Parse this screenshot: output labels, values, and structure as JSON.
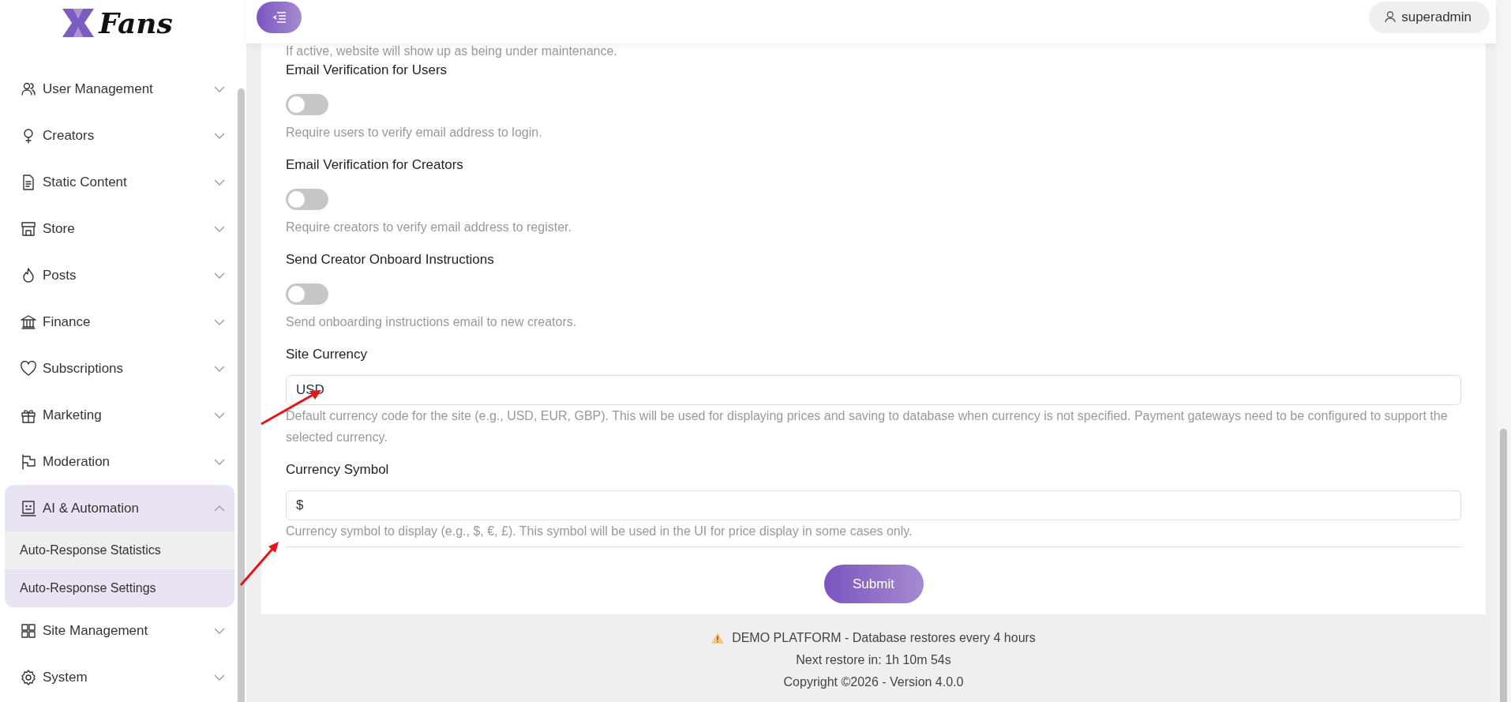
{
  "logo": {
    "text": "Fans"
  },
  "sidebar": {
    "items": [
      {
        "label": "User Management",
        "expanded": false
      },
      {
        "label": "Creators",
        "expanded": false
      },
      {
        "label": "Static Content",
        "expanded": false
      },
      {
        "label": "Store",
        "expanded": false
      },
      {
        "label": "Posts",
        "expanded": false
      },
      {
        "label": "Finance",
        "expanded": false
      },
      {
        "label": "Subscriptions",
        "expanded": false
      },
      {
        "label": "Marketing",
        "expanded": false
      },
      {
        "label": "Moderation",
        "expanded": false
      },
      {
        "label": "AI & Automation",
        "expanded": true,
        "children": [
          {
            "label": "Auto-Response Statistics",
            "selected": false
          },
          {
            "label": "Auto-Response Settings",
            "selected": true
          }
        ]
      },
      {
        "label": "Site Management",
        "expanded": false
      },
      {
        "label": "System",
        "expanded": false
      }
    ]
  },
  "header": {
    "user": "superadmin"
  },
  "settings": [
    {
      "kind": "note",
      "help": "If active, website will show up as being under maintenance."
    },
    {
      "kind": "toggle",
      "label": "Email Verification for Users",
      "on": false,
      "help": "Require users to verify email address to login."
    },
    {
      "kind": "toggle",
      "label": "Email Verification for Creators",
      "on": false,
      "help": "Require creators to verify email address to register."
    },
    {
      "kind": "toggle",
      "label": "Send Creator Onboard Instructions",
      "on": false,
      "help": "Send onboarding instructions email to new creators."
    },
    {
      "kind": "text",
      "label": "Site Currency",
      "value": "USD",
      "help": "Default currency code for the site (e.g., USD, EUR, GBP). This will be used for displaying prices and saving to database when currency is not specified. Payment gateways need to be configured to support the selected currency."
    },
    {
      "kind": "text",
      "label": "Currency Symbol",
      "value": "$",
      "help": "Currency symbol to display (e.g., $, €, £). This symbol will be used in the UI for price display in some cases only."
    }
  ],
  "submit": "Submit",
  "footer": {
    "notice": "DEMO PLATFORM - Database restores every 4 hours",
    "next_restore": "Next restore in: 1h 10m 54s",
    "copyright": "Copyright ©2026 - Version 4.0.0"
  }
}
